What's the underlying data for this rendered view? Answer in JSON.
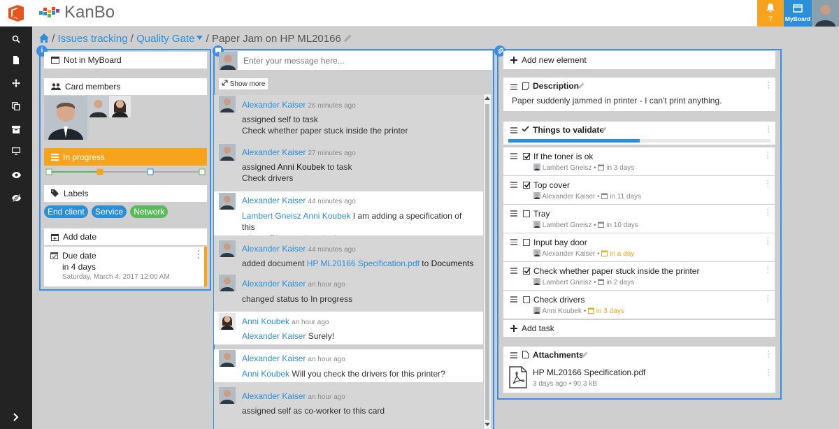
{
  "app": {
    "name": "KanBo",
    "notifications": "7",
    "myboard_label": "MyBoard"
  },
  "breadcrumb": {
    "sep": "/",
    "item1": "Issues tracking",
    "item2": "Quality Gate",
    "current": "Paper Jam on HP ML20166"
  },
  "left": {
    "not_in_myboard": "Not in MyBoard",
    "card_members": "Card members",
    "status": "In progress",
    "labels_title": "Labels",
    "labels": [
      {
        "text": "End client",
        "color": "#2b8fd8"
      },
      {
        "text": "Service",
        "color": "#2b8fd8"
      },
      {
        "text": "Network",
        "color": "#5cb85c"
      }
    ],
    "add_date": "Add date",
    "due_label": "Due date",
    "due_rel": "in 4 days",
    "due_full": "Saturday, March 4, 2017 12:00 AM"
  },
  "chat": {
    "placeholder": "Enter your message here...",
    "show_more": "Show more",
    "messages": [
      {
        "author": "Alexander Kaiser",
        "time": "26 minutes ago",
        "l1": "assigned self to task",
        "l2": "Check whether paper stuck inside the printer"
      },
      {
        "author": "Alexander Kaiser",
        "time": "27 minutes ago",
        "p1": "assigned ",
        "p2": "Anni Koubek",
        "p3": " to task",
        "l2": "Check drivers"
      },
      {
        "author": "Alexander Kaiser",
        "time": "44 minutes ago",
        "mention": "Lambert Gneisz Anni Koubek",
        "l1": " I am adding a specification of this",
        "l2": "printer. Please take a look."
      },
      {
        "author": "Alexander Kaiser",
        "time": "44 minutes ago",
        "p1": "added document ",
        "link": "HP ML20166 Specification.pdf",
        "p3": " to ",
        "p4": "Documents"
      },
      {
        "author": "Alexander Kaiser",
        "time": "an hour ago",
        "l1": "changed status to In progress"
      },
      {
        "author": "Anni Koubek",
        "time": "an hour ago",
        "mention": "Alexander Kaiser",
        "l1": " Surely!"
      },
      {
        "author": "Alexander Kaiser",
        "time": "an hour ago",
        "mention": "Anni Koubek",
        "l1": " Will you check the drivers for this printer?"
      },
      {
        "author": "Alexander Kaiser",
        "time": "an hour ago",
        "l1": "assigned self as co-worker to this card"
      }
    ]
  },
  "right": {
    "add_new_element": "Add new element",
    "description_title": "Description",
    "description_text": "Paper suddenly jammed in printer - I can't print anything.",
    "todo_title": "Things to validate",
    "todo_progress": 0.5,
    "tasks": [
      {
        "title": "If the toner is ok",
        "checked": true,
        "user": "Lambert Gneisz",
        "due": "in 3 days",
        "soon": false
      },
      {
        "title": "Top cover",
        "checked": true,
        "user": "Alexander Kaiser",
        "due": "in 11 days",
        "soon": false
      },
      {
        "title": "Tray",
        "checked": false,
        "user": "Lambert Gneisz",
        "due": "in 10 days",
        "soon": false
      },
      {
        "title": "Input bay door",
        "checked": false,
        "user": "Alexander Kaiser",
        "due": "in a day",
        "soon": true
      },
      {
        "title": "Check whether paper stuck inside the printer",
        "checked": true,
        "user": "Lambert Gneisz",
        "due": "in 2 days",
        "soon": false
      },
      {
        "title": "Check drivers",
        "checked": false,
        "user": "Anni Koubek",
        "due": "in 3 days",
        "soon": true
      }
    ],
    "add_task": "Add task",
    "attachments_title": "Attachments",
    "file_name": "HP ML20166 Specification.pdf",
    "file_meta": "3 days ago • 90.3 kB"
  },
  "colors": {
    "accent": "#2b8fd8",
    "orange": "#f7a31c",
    "green": "#5cb85c"
  }
}
